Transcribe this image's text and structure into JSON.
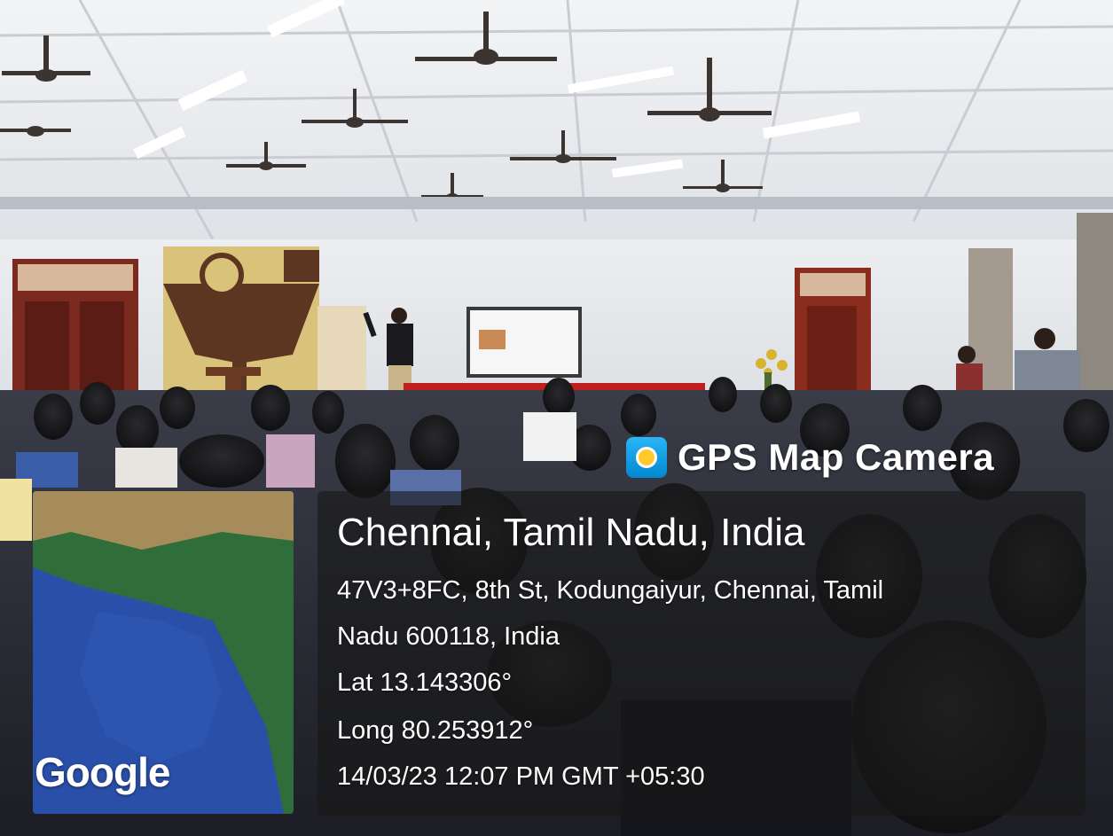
{
  "overlay": {
    "app_name": "GPS Map Camera",
    "app_icon": "map-camera-icon",
    "location_title": "Chennai, Tamil Nadu, India",
    "address_line1": "47V3+8FC, 8th St, Kodungaiyur, Chennai, Tamil",
    "address_line2": "Nadu 600118, India",
    "latitude": "Lat 13.143306°",
    "longitude": "Long 80.253912°",
    "timestamp": "14/03/23 12:07 PM GMT +05:30"
  },
  "map": {
    "provider_logo": "Google"
  }
}
